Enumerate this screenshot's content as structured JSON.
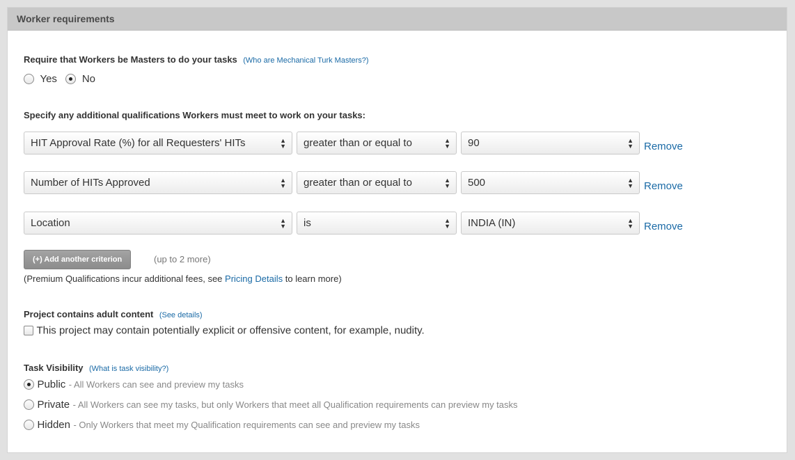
{
  "section": {
    "title": "Worker requirements"
  },
  "masters": {
    "label": "Require that Workers be Masters to do your tasks",
    "help_link": "(Who are Mechanical Turk Masters?)",
    "options": [
      {
        "label": "Yes",
        "checked": false
      },
      {
        "label": "No",
        "checked": true
      }
    ]
  },
  "qualifications": {
    "label": "Specify any additional qualifications Workers must meet to work on your tasks:",
    "rows": [
      {
        "qualification": "HIT Approval Rate (%) for all Requesters' HITs",
        "comparator": "greater than or equal to",
        "value": "90",
        "remove": "Remove"
      },
      {
        "qualification": "Number of HITs Approved",
        "comparator": "greater than or equal to",
        "value": "500",
        "remove": "Remove"
      },
      {
        "qualification": "Location",
        "comparator": "is",
        "value": "INDIA (IN)",
        "remove": "Remove"
      }
    ],
    "add_button": "(+) Add another criterion",
    "add_hint": "(up to 2 more)",
    "premium_note_prefix": "(Premium Qualifications incur additional fees, see ",
    "premium_note_link": "Pricing Details",
    "premium_note_suffix": " to learn more)"
  },
  "adult": {
    "label": "Project contains adult content",
    "help_link": "(See details)",
    "checkbox_label": "This project may contain potentially explicit or offensive content, for example, nudity.",
    "checked": false
  },
  "visibility": {
    "label": "Task Visibility",
    "help_link": "(What is task visibility?)",
    "options": [
      {
        "label": "Public",
        "desc": "- All Workers can see and preview my tasks",
        "checked": true
      },
      {
        "label": "Private",
        "desc": "- All Workers can see my tasks, but only Workers that meet all Qualification requirements can preview my tasks",
        "checked": false
      },
      {
        "label": "Hidden",
        "desc": "- Only Workers that meet my Qualification requirements can see and preview my tasks",
        "checked": false
      }
    ]
  },
  "colors": {
    "link": "#1a6aa6",
    "header_bg": "#c8c8c8",
    "button_bg": "#8c8c8c"
  },
  "icons": {
    "select_arrows": "updown-arrows-icon"
  }
}
